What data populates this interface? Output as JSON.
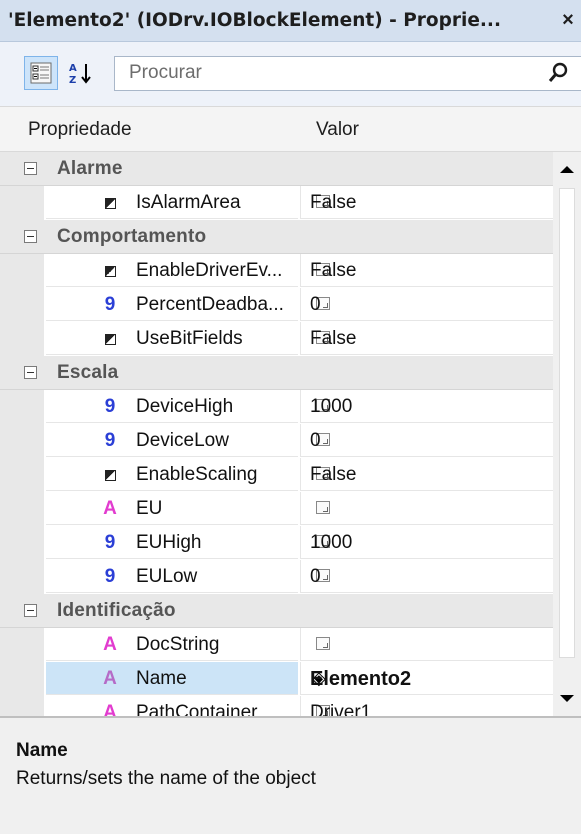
{
  "window": {
    "title": "'Elemento2' (IODrv.IOBlockElement) - Proprie...",
    "close": "×"
  },
  "toolbar": {
    "categorized_icon": "categorized-view-icon",
    "sort_icon": "alphabetical-sort-icon",
    "search_placeholder": "Procurar",
    "search_icon": "search-icon"
  },
  "grid_header": {
    "name_col": "Propriedade",
    "value_col": "Valor"
  },
  "categories": [
    {
      "label": "Alarme"
    },
    {
      "label": "Comportamento"
    },
    {
      "label": "Escala"
    },
    {
      "label": "Identificação"
    }
  ],
  "properties": [
    {
      "name": "IsAlarmArea",
      "type": "bool",
      "value": "False"
    },
    {
      "name": "EnableDriverEv...",
      "type": "bool",
      "value": "False"
    },
    {
      "name": "PercentDeadba...",
      "type": "num",
      "value": "0"
    },
    {
      "name": "UseBitFields",
      "type": "bool",
      "value": "False"
    },
    {
      "name": "DeviceHigh",
      "type": "num",
      "value": "1000"
    },
    {
      "name": "DeviceLow",
      "type": "num",
      "value": "0"
    },
    {
      "name": "EnableScaling",
      "type": "bool",
      "value": "False"
    },
    {
      "name": "EU",
      "type": "str",
      "value": ""
    },
    {
      "name": "EUHigh",
      "type": "num",
      "value": "1000"
    },
    {
      "name": "EULow",
      "type": "num",
      "value": "0"
    },
    {
      "name": "DocString",
      "type": "str",
      "value": ""
    },
    {
      "name": "Name",
      "type": "str",
      "value": "Elemento2"
    },
    {
      "name": "PathContainer",
      "type": "str",
      "value": "Driver1"
    }
  ],
  "icon_glyphs": {
    "num": "9",
    "str": "A"
  },
  "description": {
    "title": "Name",
    "text": "Returns/sets the name of the object"
  },
  "colors": {
    "selected_row": "#cce4f7",
    "number_icon": "#2b3fd6",
    "string_icon": "#e23ccf"
  }
}
